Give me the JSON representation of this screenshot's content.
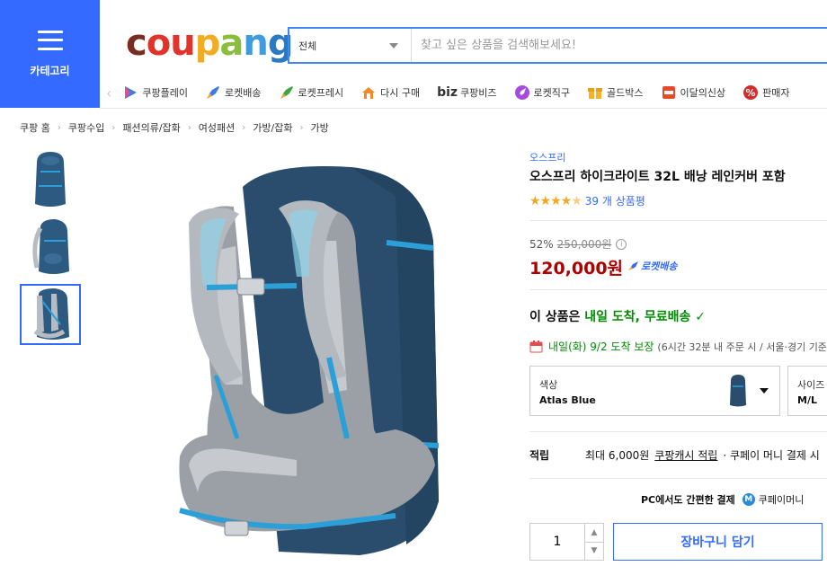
{
  "header": {
    "category_label": "카테고리",
    "logo_text": [
      "c",
      "ou",
      "p",
      "a",
      "n",
      "g"
    ],
    "search_category": "전체",
    "search_placeholder": "찾고 싶은 상품을 검색해보세요!"
  },
  "quick_nav": [
    {
      "label": "쿠팡플레이",
      "icon": "play-icon"
    },
    {
      "label": "로켓배송",
      "icon": "rocket-icon"
    },
    {
      "label": "로켓프레시",
      "icon": "rocket-fresh-icon"
    },
    {
      "label": "다시 구매",
      "icon": "home-repurchase-icon"
    },
    {
      "label": "쿠팡비즈",
      "icon": "biz-icon",
      "prefix": "biz"
    },
    {
      "label": "로켓직구",
      "icon": "rocket-global-icon"
    },
    {
      "label": "골드박스",
      "icon": "gift-box-icon"
    },
    {
      "label": "이달의신상",
      "icon": "new-badge-icon"
    },
    {
      "label": "판매자",
      "icon": "percent-icon"
    }
  ],
  "breadcrumb": [
    "쿠팡 홈",
    "쿠팡수입",
    "패션의류/잡화",
    "여성패션",
    "가방/잡화",
    "가방"
  ],
  "product": {
    "brand": "오스프리",
    "title": "오스프리 하이크라이트 32L 배낭 레인커버 포함",
    "rating": 4.5,
    "review_text": "39 개 상품평",
    "discount": "52%",
    "original_price": "250,000원",
    "price": "120,000원",
    "rocket_label": "로켓배송",
    "delivery_prefix": "이 상품은 ",
    "delivery_highlight": "내일 도착, 무료배송",
    "arrival_main": "내일(화) 9/2 도착 보장",
    "arrival_note": "(6시간 32분 내 주문 시 / 서울·경기 기준)",
    "options": [
      {
        "label": "색상",
        "value": "Atlas Blue"
      },
      {
        "label": "사이즈",
        "value": "M/L"
      }
    ],
    "points_label": "적립",
    "points_max": "최대 6,000원",
    "points_cash": "쿠팡캐시 적립",
    "points_extra": "· 쿠페이 머니 결제 시",
    "pc_pay": "PC에서도 간편한 결제",
    "pc_pay_brand": "쿠페이머니",
    "quantity": "1",
    "cart_label": "장바구니 담기"
  },
  "colors": {
    "accent": "#346aff",
    "price": "#ae0000",
    "delivery": "#008c00",
    "backpack_body": "#2a4d6e",
    "backpack_strap": "#2ba0d8"
  }
}
